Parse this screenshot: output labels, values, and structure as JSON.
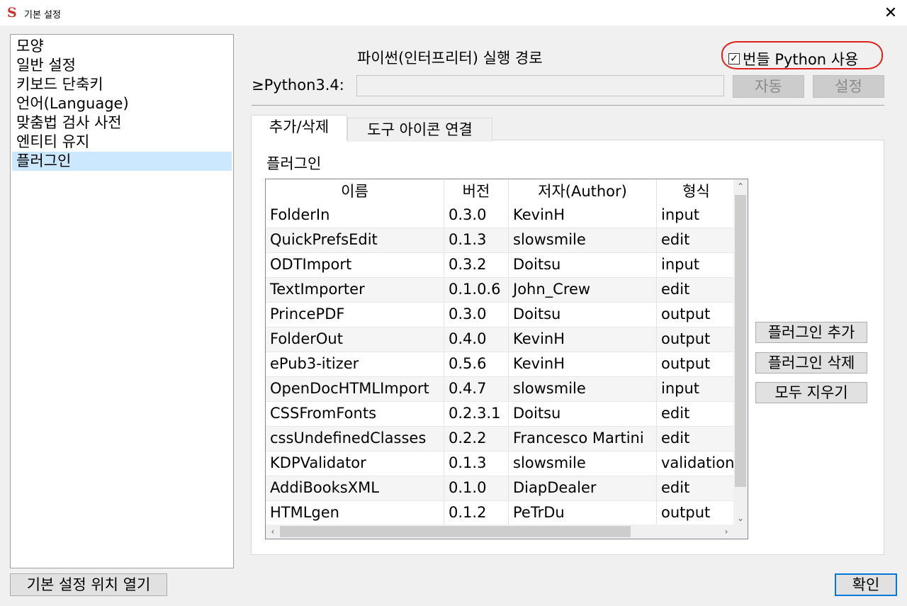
{
  "window": {
    "title": "기본 설정",
    "app_icon_glyph": "S",
    "close_glyph": "✕"
  },
  "sidebar": {
    "items": [
      {
        "label": "모양"
      },
      {
        "label": "일반 설정"
      },
      {
        "label": "키보드 단축키"
      },
      {
        "label": "언어(Language)"
      },
      {
        "label": "맞춤법 검사 사전"
      },
      {
        "label": "엔티티 유지"
      },
      {
        "label": "플러그인"
      }
    ],
    "selected": "플러그인"
  },
  "footer": {
    "open_location_label": "기본 설정 위치 열기",
    "ok_label": "확인"
  },
  "python": {
    "heading": "파이썬(인터프리터) 실행 경로",
    "bundled_label": "번들 Python 사용",
    "bundled_checked": true,
    "check_glyph": "✓",
    "version_label": "≥Python3.4:",
    "path_value": "",
    "auto_label": "자동",
    "set_label": "설정"
  },
  "tabs": [
    {
      "label": "추가/삭제",
      "active": true
    },
    {
      "label": "도구 아이콘 연결",
      "active": false
    }
  ],
  "plugins": {
    "section_label": "플러그인",
    "columns": [
      "이름",
      "버전",
      "저자(Author)",
      "형식"
    ],
    "rows": [
      [
        "FolderIn",
        "0.3.0",
        "KevinH",
        "input"
      ],
      [
        "QuickPrefsEdit",
        "0.1.3",
        "slowsmile",
        "edit"
      ],
      [
        "ODTImport",
        "0.3.2",
        "Doitsu",
        "input"
      ],
      [
        "TextImporter",
        "0.1.0.6",
        "John_Crew",
        "edit"
      ],
      [
        "PrincePDF",
        "0.3.0",
        "Doitsu",
        "output"
      ],
      [
        "FolderOut",
        "0.4.0",
        "KevinH",
        "output"
      ],
      [
        "ePub3-itizer",
        "0.5.6",
        "KevinH",
        "output"
      ],
      [
        "OpenDocHTMLImport",
        "0.4.7",
        "slowsmile",
        "input"
      ],
      [
        "CSSFromFonts",
        "0.2.3.1",
        "Doitsu",
        "edit"
      ],
      [
        "cssUndefinedClasses",
        "0.2.2",
        "Francesco Martini",
        "edit"
      ],
      [
        "KDPValidator",
        "0.1.3",
        "slowsmile",
        "validation"
      ],
      [
        "AddiBooksXML",
        "0.1.0",
        "DiapDealer",
        "edit"
      ],
      [
        "HTMLgen",
        "0.1.2",
        "PeTrDu",
        "output"
      ]
    ],
    "add_label": "플러그인 추가",
    "remove_label": "플러그인 삭제",
    "clear_label": "모두 지우기"
  },
  "scroll": {
    "up": "⌃",
    "down": "⌄",
    "left": "‹",
    "right": "›"
  },
  "colors": {
    "selection": "#cce8ff",
    "annotation_circle": "#e0201c",
    "default_button_border": "#0078d7"
  }
}
